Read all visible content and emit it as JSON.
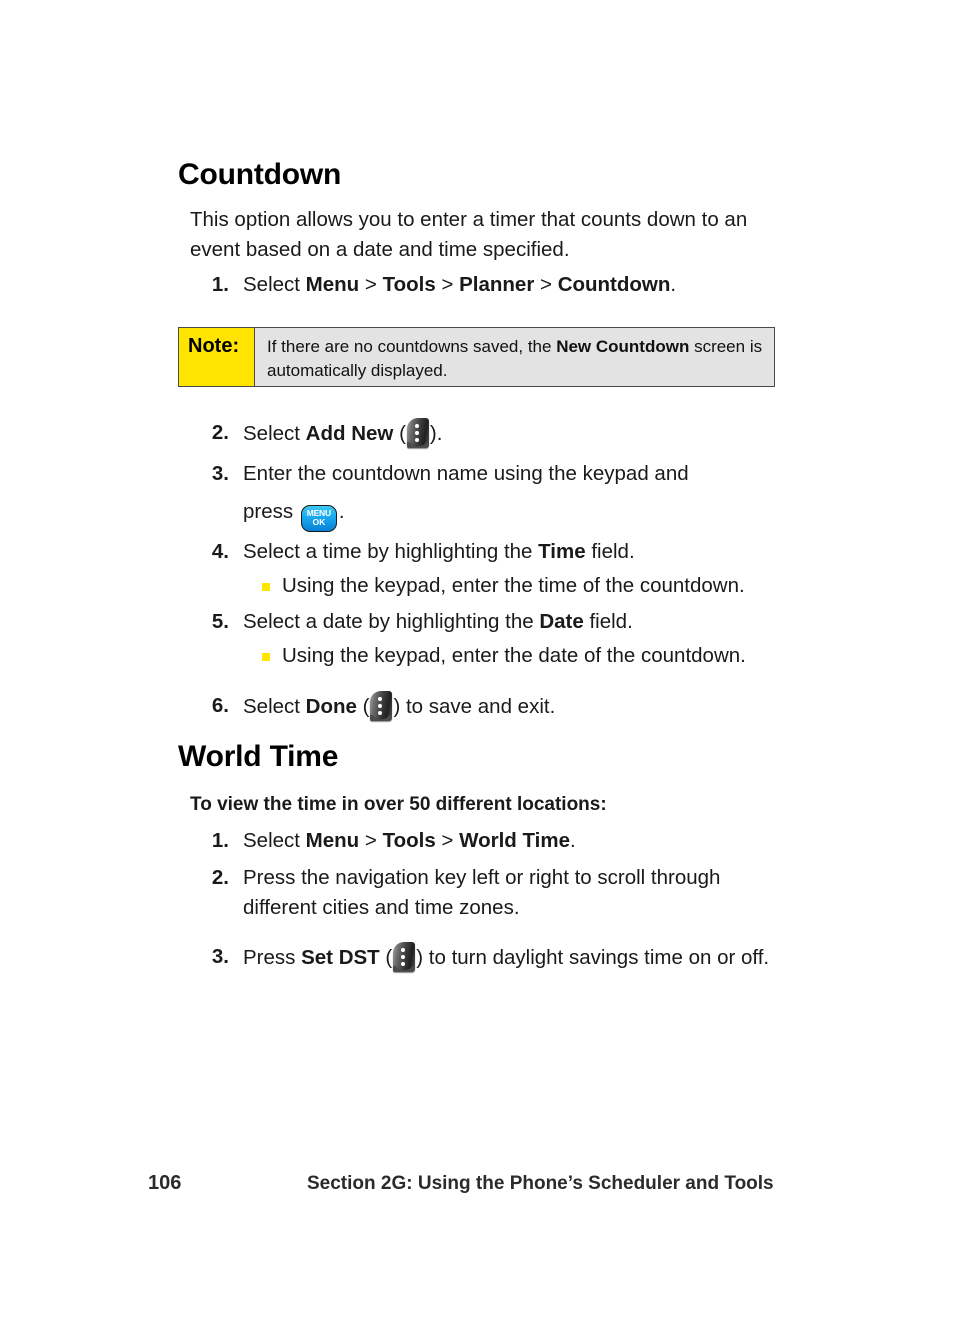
{
  "page": {
    "number": "106",
    "footer_title": "Section 2G: Using the Phone’s Scheduler and Tools"
  },
  "sections": [
    {
      "heading": "Countdown",
      "intro": "This option allows you to enter a timer that counts down to an event based on a date and time specified."
    },
    {
      "heading": "World Time",
      "intro": "To view the time in over 50 different locations:"
    }
  ],
  "countdown": {
    "heading": "Countdown",
    "intro": "This option allows you to enter a timer that counts down to an event based on a date and time specified.",
    "steps": {
      "s1": {
        "num": "1.",
        "pre": "Select ",
        "b1": "Menu",
        "sep1": " > ",
        "b2": "Tools",
        "sep2": " > ",
        "b3": "Planner",
        "sep3": " > ",
        "b4": "Countdown",
        "post": "."
      },
      "s2": {
        "num": "2.",
        "pre": "Select ",
        "bold": "Add New",
        "mid": " (",
        "post": ")."
      },
      "s3": {
        "num": "3.",
        "line1": "Enter the countdown name using the keypad and",
        "line2_pre": "press ",
        "line2_post": "."
      },
      "s4": {
        "num": "4.",
        "pre": "Select a time by highlighting the ",
        "bold": "Time",
        "post": " field."
      },
      "s4sub": "Using the keypad, enter the time of the countdown.",
      "s5": {
        "num": "5.",
        "pre": "Select a date by highlighting the ",
        "bold": "Date",
        "post": " field."
      },
      "s5sub": "Using the keypad, enter the date of the countdown.",
      "s6": {
        "num": "6.",
        "pre": "Select ",
        "bold": "Done",
        "mid": " (",
        "post": ") to save and exit."
      }
    }
  },
  "note": {
    "label": "Note:",
    "text_pre": "If there are no countdowns saved, the ",
    "text_bold": "New Countdown",
    "text_post": " screen is automatically displayed."
  },
  "worldtime": {
    "heading": "World Time",
    "intro": "To view the time in over 50 different locations:",
    "steps": {
      "s1": {
        "num": "1.",
        "pre": "Select ",
        "b1": "Menu",
        "sep1": " > ",
        "b2": "Tools",
        "sep2": " > ",
        "b3": "World Time",
        "post": "."
      },
      "s2": {
        "num": "2.",
        "text": "Press the navigation key left or right to scroll through different cities and time zones."
      },
      "s3": {
        "num": "3.",
        "pre": "Press ",
        "bold": "Set DST",
        "mid": " (",
        "post": ") to turn daylight savings time on or off."
      }
    }
  },
  "icons": {
    "softkey": "softkey-three-dots-icon",
    "menu_ok": {
      "name": "menu-ok-key-icon",
      "line1": "MENU",
      "line2": "OK"
    },
    "bullet": "yellow-square-bullet-icon"
  },
  "colors": {
    "note_label_bg": "#FFE400",
    "note_body_bg": "#E3E3E3",
    "note_border": "#4A4A4A",
    "bullet": "#FFE400",
    "menu_key_blue": "#19A9EE",
    "text": "#1A1A1A"
  }
}
